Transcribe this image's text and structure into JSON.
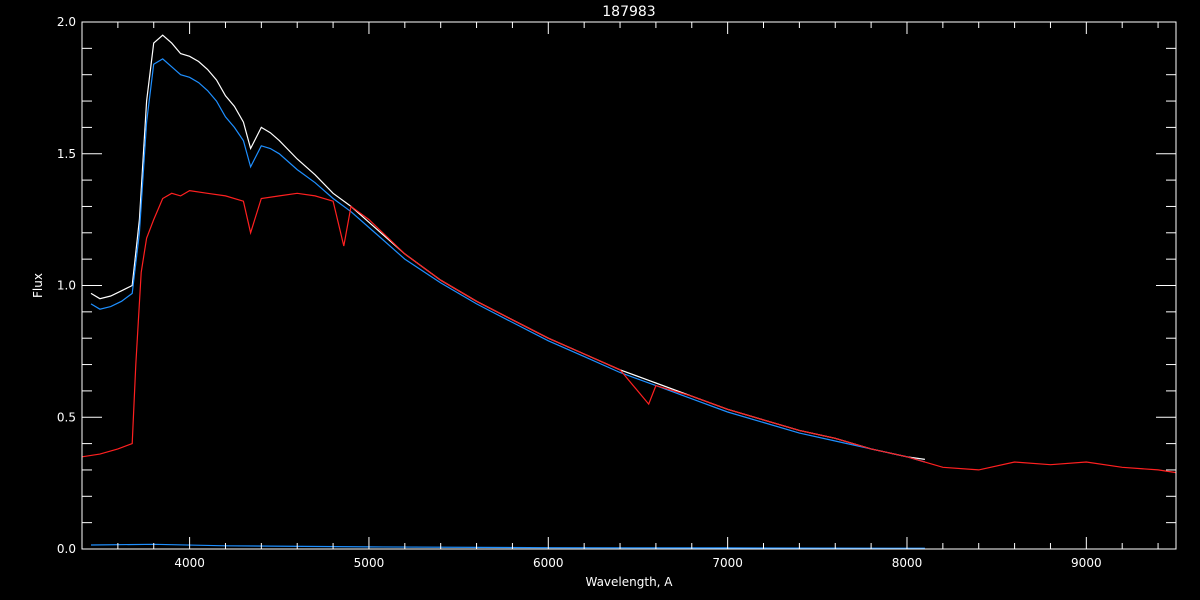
{
  "chart_data": {
    "type": "line",
    "title": "187983",
    "xlabel": "Wavelength, A",
    "ylabel": "Flux",
    "xlim": [
      3400,
      9500
    ],
    "ylim": [
      0.0,
      2.0
    ],
    "x_ticks": [
      4000,
      5000,
      6000,
      7000,
      8000,
      9000
    ],
    "x_tick_labels": [
      "4000",
      "5000",
      "6000",
      "7000",
      "8000",
      "9000"
    ],
    "y_ticks": [
      0.0,
      0.5,
      1.0,
      1.5,
      2.0
    ],
    "y_tick_labels": [
      "0.0",
      "0.5",
      "1.0",
      "1.5",
      "2.0"
    ],
    "background": "#000000",
    "axis_color": "#ffffff",
    "grid": false,
    "series": [
      {
        "color": "#ffffff",
        "x": [
          3450,
          3500,
          3560,
          3620,
          3680,
          3720,
          3760,
          3800,
          3850,
          3900,
          3950,
          4000,
          4050,
          4100,
          4150,
          4200,
          4250,
          4300,
          4340,
          4400,
          4450,
          4500,
          4600,
          4700,
          4800,
          4900,
          5000,
          5200,
          5400,
          5600,
          5800,
          6000,
          6200,
          6400,
          6600,
          6800,
          7000,
          7200,
          7400,
          7600,
          7800,
          8000,
          8100
        ],
        "y": [
          0.97,
          0.95,
          0.96,
          0.98,
          1.0,
          1.25,
          1.7,
          1.92,
          1.95,
          1.92,
          1.88,
          1.87,
          1.85,
          1.82,
          1.78,
          1.72,
          1.68,
          1.62,
          1.52,
          1.6,
          1.58,
          1.55,
          1.48,
          1.42,
          1.35,
          1.3,
          1.24,
          1.12,
          1.02,
          0.94,
          0.87,
          0.8,
          0.74,
          0.68,
          0.63,
          0.58,
          0.53,
          0.49,
          0.45,
          0.42,
          0.38,
          0.35,
          0.34
        ]
      },
      {
        "color": "#1e8fff",
        "x": [
          3450,
          3500,
          3560,
          3620,
          3680,
          3720,
          3760,
          3800,
          3850,
          3900,
          3950,
          4000,
          4050,
          4100,
          4150,
          4200,
          4250,
          4300,
          4340,
          4400,
          4450,
          4500,
          4600,
          4700,
          4800,
          4900,
          5000,
          5200,
          5400,
          5600,
          5800,
          6000,
          6200,
          6400,
          6600,
          6800,
          7000,
          7200,
          7400,
          7600,
          7800,
          8000,
          8100
        ],
        "y": [
          0.93,
          0.91,
          0.92,
          0.94,
          0.97,
          1.2,
          1.62,
          1.84,
          1.86,
          1.83,
          1.8,
          1.79,
          1.77,
          1.74,
          1.7,
          1.64,
          1.6,
          1.55,
          1.45,
          1.53,
          1.52,
          1.5,
          1.44,
          1.39,
          1.33,
          1.28,
          1.22,
          1.1,
          1.01,
          0.93,
          0.86,
          0.79,
          0.73,
          0.67,
          0.62,
          0.57,
          0.52,
          0.48,
          0.44,
          0.41,
          0.38,
          0.35,
          0.33
        ]
      },
      {
        "color": "#ff2020",
        "x": [
          3400,
          3500,
          3600,
          3680,
          3700,
          3730,
          3760,
          3800,
          3850,
          3900,
          3950,
          4000,
          4100,
          4200,
          4300,
          4340,
          4400,
          4500,
          4600,
          4700,
          4800,
          4860,
          4900,
          5000,
          5200,
          5400,
          5600,
          5800,
          6000,
          6200,
          6400,
          6560,
          6600,
          6800,
          7000,
          7200,
          7400,
          7600,
          7800,
          8000,
          8200,
          8400,
          8600,
          8800,
          9000,
          9200,
          9400,
          9500
        ],
        "y": [
          0.35,
          0.36,
          0.38,
          0.4,
          0.7,
          1.05,
          1.18,
          1.25,
          1.33,
          1.35,
          1.34,
          1.36,
          1.35,
          1.34,
          1.32,
          1.2,
          1.33,
          1.34,
          1.35,
          1.34,
          1.32,
          1.15,
          1.3,
          1.25,
          1.12,
          1.02,
          0.94,
          0.87,
          0.8,
          0.74,
          0.68,
          0.55,
          0.62,
          0.58,
          0.53,
          0.49,
          0.45,
          0.42,
          0.38,
          0.35,
          0.31,
          0.3,
          0.33,
          0.32,
          0.33,
          0.31,
          0.3,
          0.29
        ]
      },
      {
        "color": "#1e8fff",
        "x": [
          3450,
          3800,
          4200,
          5000,
          6000,
          7000,
          8000,
          8100
        ],
        "y": [
          0.015,
          0.018,
          0.012,
          0.008,
          0.005,
          0.004,
          0.003,
          0.003
        ]
      }
    ]
  }
}
